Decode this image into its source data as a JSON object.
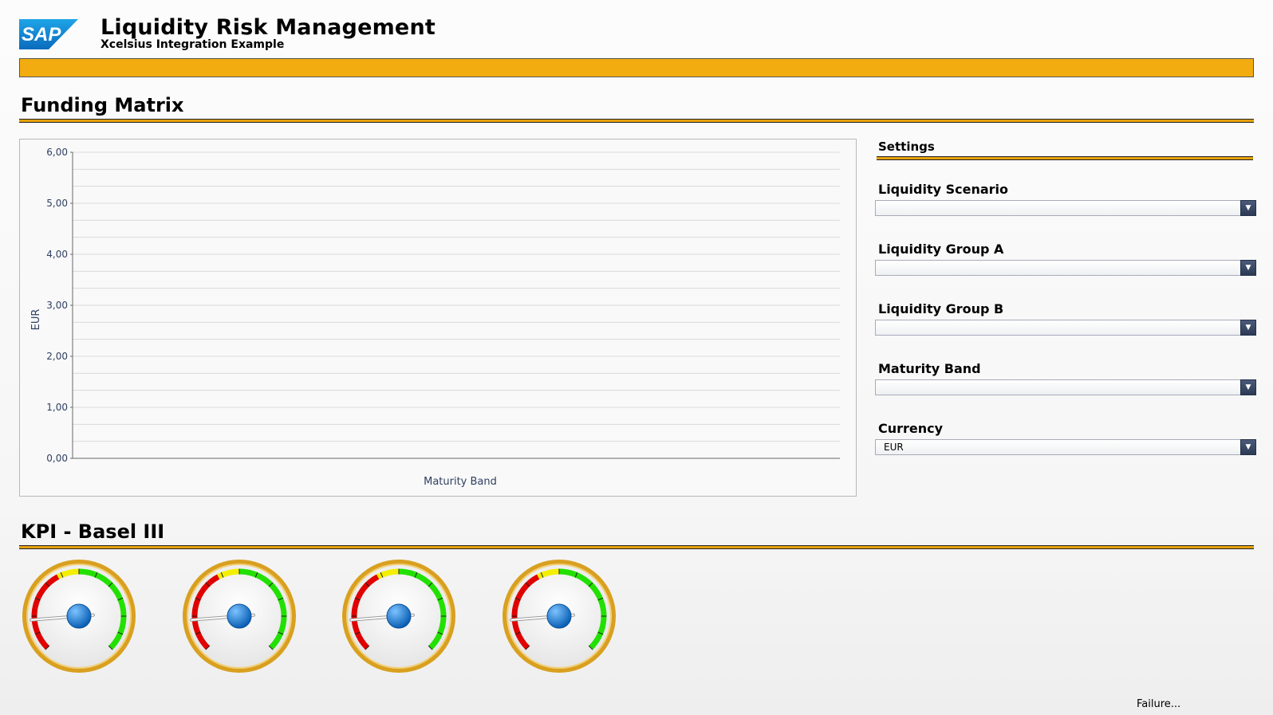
{
  "header": {
    "logo_text": "SAP",
    "title": "Liquidity Risk Management",
    "subtitle": "Xcelsius Integration Example"
  },
  "funding_section": {
    "title": "Funding Matrix"
  },
  "chart_data": {
    "type": "bar",
    "categories": [],
    "values": [],
    "title": "",
    "xlabel": "Maturity Band",
    "ylabel": "EUR",
    "ylim": [
      0,
      6
    ],
    "y_ticks": [
      "0,00",
      "1,00",
      "2,00",
      "3,00",
      "4,00",
      "5,00",
      "6,00"
    ],
    "grid": true,
    "legend": "none"
  },
  "settings": {
    "title": "Settings",
    "fields": [
      {
        "label": "Liquidity Scenario",
        "value": ""
      },
      {
        "label": "Liquidity Group A",
        "value": ""
      },
      {
        "label": "Liquidity Group B",
        "value": ""
      },
      {
        "label": "Maturity Band",
        "value": ""
      },
      {
        "label": "Currency",
        "value": "EUR"
      }
    ]
  },
  "kpi_section": {
    "title": "KPI - Basel III",
    "gauges": [
      {
        "needle_value": 0.15
      },
      {
        "needle_value": 0.15
      },
      {
        "needle_value": 0.15
      },
      {
        "needle_value": 0.15
      }
    ]
  },
  "status": {
    "text": "Failure..."
  },
  "colors": {
    "accent_orange": "#f2ac10",
    "gauge_red": "#e00000",
    "gauge_yellow": "#f4ef00",
    "gauge_green": "#22e000",
    "gauge_rim": "#d9a020",
    "axis_text": "#2e3f60"
  }
}
